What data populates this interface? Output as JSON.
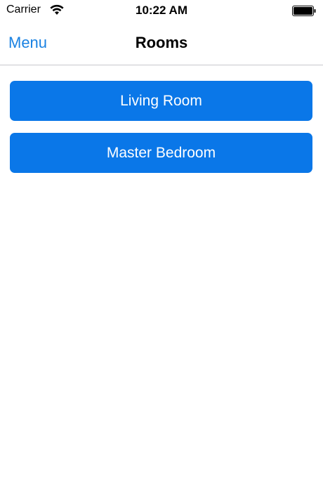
{
  "status_bar": {
    "carrier": "Carrier",
    "time": "10:22 AM",
    "wifi_icon": "wifi-icon",
    "battery_icon": "battery-icon"
  },
  "nav": {
    "back_label": "Menu",
    "title": "Rooms"
  },
  "rooms": [
    {
      "label": "Living Room"
    },
    {
      "label": "Master Bedroom"
    }
  ],
  "colors": {
    "accent": "#1a82e2",
    "button_fill": "#0a77e8",
    "button_text": "#ffffff",
    "separator": "#c8c7cc"
  }
}
